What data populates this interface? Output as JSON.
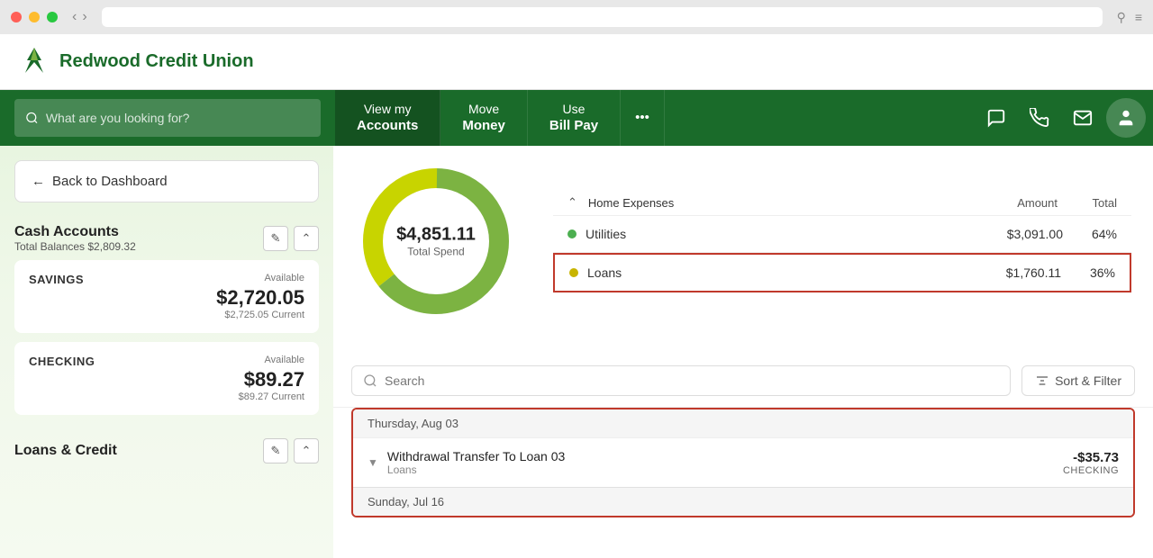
{
  "titlebar": {
    "btn_red": "●",
    "btn_yellow": "●",
    "btn_green": "●"
  },
  "header": {
    "logo_text": "Redwood Credit Union"
  },
  "navbar": {
    "search_placeholder": "What are you looking for?",
    "nav_view_my": "View my",
    "nav_accounts": "Accounts",
    "nav_move": "Move",
    "nav_money": "Money",
    "nav_use": "Use",
    "nav_bill_pay": "Bill Pay",
    "nav_dots": "•••"
  },
  "sidebar": {
    "back_btn": "Back to Dashboard",
    "cash_accounts_title": "Cash Accounts",
    "cash_accounts_balance": "Total Balances $2,809.32",
    "savings_type": "SAVINGS",
    "savings_available": "Available",
    "savings_amount": "$2,720.05",
    "savings_current": "$2,725.05 Current",
    "checking_type": "CHECKING",
    "checking_available": "Available",
    "checking_amount": "$89.27",
    "checking_current": "$89.27 Current",
    "loans_credit_title": "Loans & Credit"
  },
  "chart": {
    "total_amount": "$4,851.11",
    "total_label": "Total Spend"
  },
  "expenses_table": {
    "group_label": "Home Expenses",
    "col_amount": "Amount",
    "col_total": "Total",
    "row1_category": "Utilities",
    "row1_amount": "$3,091.00",
    "row1_percent": "64%",
    "row2_category": "Loans",
    "row2_amount": "$1,760.11",
    "row2_percent": "36%"
  },
  "search_bar": {
    "placeholder": "Search",
    "sort_filter_label": "Sort & Filter"
  },
  "transactions": {
    "date1": "Thursday, Aug 03",
    "tx1_name": "Withdrawal Transfer To Loan 03",
    "tx1_category": "Loans",
    "tx1_amount": "-$35.73",
    "tx1_account": "CHECKING",
    "date2": "Sunday, Jul 16"
  }
}
